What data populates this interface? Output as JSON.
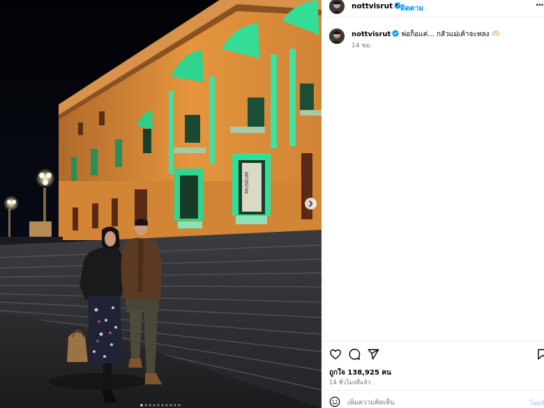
{
  "post": {
    "username": "nottvisrut",
    "follow_label": "ติดตาม",
    "separator": "•",
    "more_label": "···",
    "caption_user": "nottvisrut",
    "caption_text": "พ่อก็อแค่... กลัวแม่เค้าจะหลง 🫶🏻",
    "caption_time": "14 ชม.",
    "likes_text": "ถูกใจ 138,925 คน",
    "time_ago": "14 ชั่วโมงที่แล้ว",
    "comment_placeholder": "เพิ่มความคิดเห็น",
    "post_label": "โพสต์"
  },
  "photo": {
    "sign_text": "MUSEUM",
    "carousel_count": 10,
    "carousel_active": 1
  },
  "colors": {
    "accent": "#0095f6",
    "verified": "#0095f6",
    "secondary_text": "#737373",
    "building_light": "#e89a3a",
    "green_light": "#27d88e"
  },
  "icons": [
    "heart-icon",
    "comment-icon",
    "share-icon",
    "bookmark-icon",
    "emoji-icon",
    "verified-icon",
    "chevron-right-icon"
  ]
}
